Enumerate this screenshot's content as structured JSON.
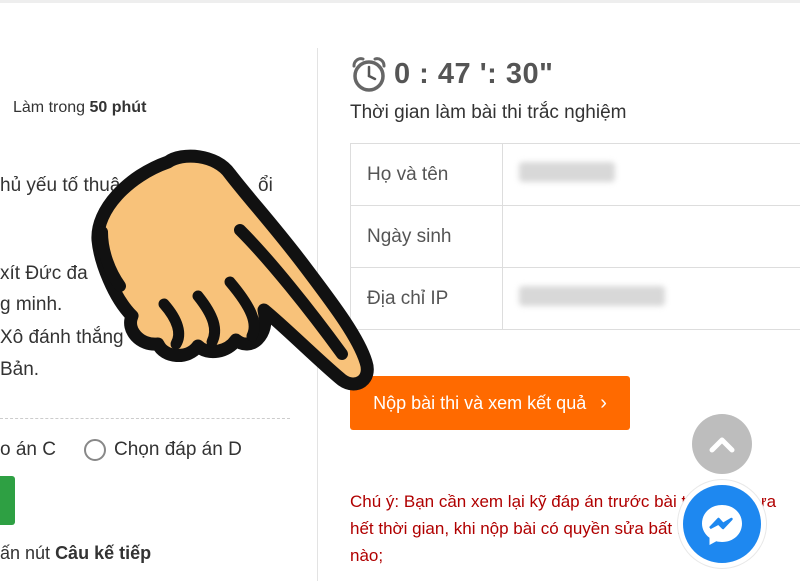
{
  "left": {
    "duration_prefix": "Làm trong",
    "duration_value": "50 phút",
    "question_lines": [
      "hủ yếu tố thuậ",
      "ổi",
      "xít Đức đa",
      "g minh.",
      "Xô đánh thắng",
      "Bản."
    ],
    "options": [
      "o án C",
      "Chọn đáp án D"
    ],
    "hint_prefix": "ấn nút",
    "hint_bold": "Câu kế tiếp"
  },
  "timer": {
    "icon": "alarm-clock-icon",
    "value": "0 : 47 ': 30\"",
    "subtitle": "Thời gian làm bài thi trắc nghiệm"
  },
  "info_table": {
    "rows": [
      {
        "label": "Họ và tên",
        "value_blurred": true
      },
      {
        "label": "Ngày sinh",
        "value_blurred": false
      },
      {
        "label": "Địa chỉ IP",
        "value_blurred": true
      }
    ]
  },
  "submit": {
    "label": "Nộp bài thi và xem kết quả",
    "chevron": "›",
    "color": "#ff6a00"
  },
  "note": {
    "text": "Chú ý: Bạn cần xem lại kỹ đáp án trước bài thi nếu chưa hết thời gian, khi nộp bài có quyền sửa bất kỳ thông tin nào;",
    "color": "#b00000"
  },
  "widgets": {
    "scroll_top_icon": "chevron-up-icon",
    "messenger_icon": "messenger-icon",
    "messenger_color": "#1e88f0"
  },
  "overlay": {
    "icon": "pointing-hand-icon"
  }
}
